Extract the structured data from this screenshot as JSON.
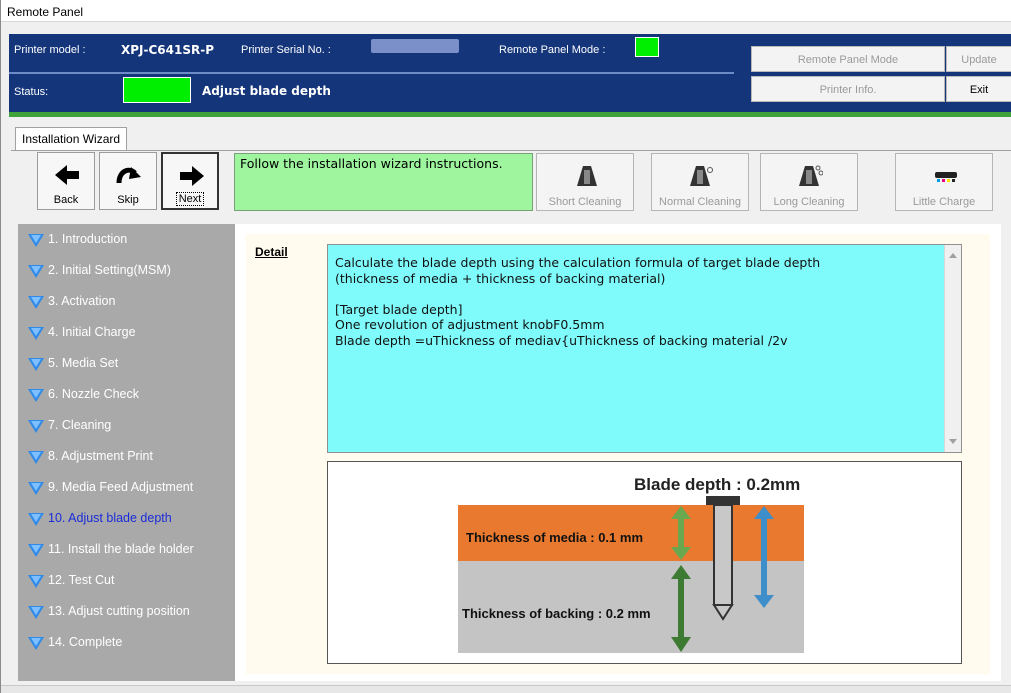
{
  "window": {
    "title": "Remote Panel"
  },
  "header": {
    "printer_model_label": "Printer model :",
    "printer_model_value": "XPJ-C641SR-P",
    "serial_label": "Printer Serial No. :",
    "mode_label": "Remote Panel Mode :",
    "status_label": "Status:",
    "status_value": "Adjust blade depth",
    "status_color": "#00ee00",
    "mode_indicator_color": "#00ee00"
  },
  "top_buttons": {
    "remote_panel_mode": "Remote Panel Mode",
    "update": "Update",
    "printer_info": "Printer Info.",
    "exit": "Exit"
  },
  "tab": {
    "label": "Installation Wizard"
  },
  "toolbar": {
    "back": "Back",
    "skip": "Skip",
    "next": "Next",
    "instruction": "Follow the installation wizard instructions.",
    "short_cleaning": "Short Cleaning",
    "normal_cleaning": "Normal Cleaning",
    "long_cleaning": "Long Cleaning",
    "little_charge": "Little Charge"
  },
  "steps": [
    "1. Introduction",
    "2. Initial Setting(MSM)",
    "3. Activation",
    "4. Initial Charge",
    "5. Media Set",
    "6. Nozzle Check",
    "7. Cleaning",
    "8. Adjustment Print",
    "9. Media Feed Adjustment",
    "10. Adjust blade depth",
    "11. Install the blade holder",
    "12. Test Cut",
    "13. Adjust cutting position",
    "14. Complete"
  ],
  "active_step_index": 9,
  "detail": {
    "label": "Detail",
    "lines": [
      "Calculate the blade depth using the calculation formula of target blade depth",
      "(thickness of media + thickness of backing material)",
      "",
      "[Target blade depth]",
      "One revolution of adjustment knobF0.5mm",
      "Blade depth =uThickness of mediav{uThickness of backing material /2v"
    ]
  },
  "figure": {
    "blade_depth": "Blade depth : 0.2mm",
    "media": "Thickness of media : 0.1 mm",
    "backing": "Thickness of backing : 0.2 mm",
    "media_color": "#e8792f",
    "backing_color": "#c4c4c4"
  }
}
